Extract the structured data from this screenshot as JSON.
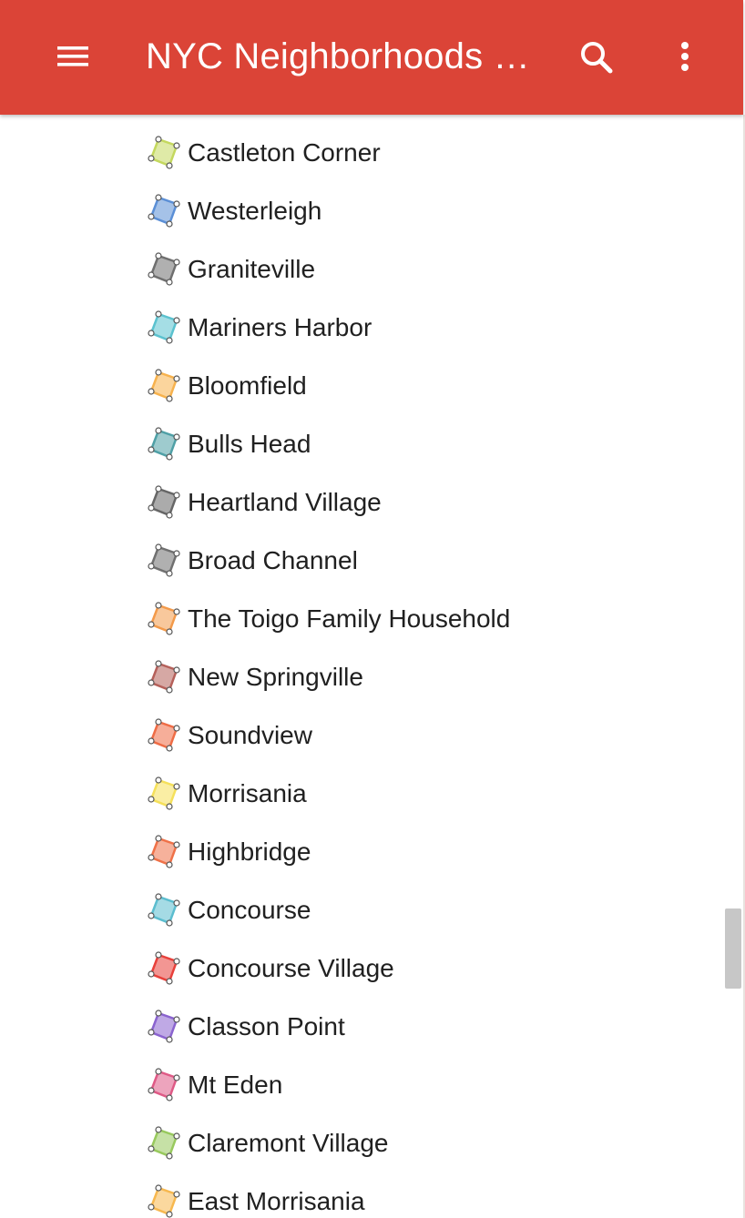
{
  "header": {
    "title": "NYC Neighborhoods M..."
  },
  "icons": {
    "menu": "hamburger-menu-icon",
    "search": "search-icon",
    "more": "more-vert-icon",
    "item": "polygon-shape-icon"
  },
  "colors": {
    "app_bar": "#db4437"
  },
  "list": {
    "items": [
      {
        "label": "Castleton Corner",
        "color": "#c4d85e"
      },
      {
        "label": "Westerleigh",
        "color": "#5b8fd6"
      },
      {
        "label": "Graniteville",
        "color": "#6f6f6f"
      },
      {
        "label": "Mariners Harbor",
        "color": "#5bc2cf"
      },
      {
        "label": "Bloomfield",
        "color": "#f7b24d"
      },
      {
        "label": "Bulls Head",
        "color": "#4fa0a6"
      },
      {
        "label": "Heartland Village",
        "color": "#666666"
      },
      {
        "label": "Broad Channel",
        "color": "#707070"
      },
      {
        "label": "The Toigo Family Household",
        "color": "#f39a4a"
      },
      {
        "label": "New Springville",
        "color": "#b5605a"
      },
      {
        "label": "Soundview",
        "color": "#ef6c45"
      },
      {
        "label": "Morrisania",
        "color": "#f5e05a"
      },
      {
        "label": "Highbridge",
        "color": "#ef7148"
      },
      {
        "label": "Concourse",
        "color": "#5bbdcf"
      },
      {
        "label": "Concourse Village",
        "color": "#e8403a"
      },
      {
        "label": "Classon Point",
        "color": "#8a63cf"
      },
      {
        "label": "Mt Eden",
        "color": "#df5a86"
      },
      {
        "label": "Claremont Village",
        "color": "#98c95d"
      },
      {
        "label": "East Morrisania",
        "color": "#f7b84f"
      }
    ]
  }
}
